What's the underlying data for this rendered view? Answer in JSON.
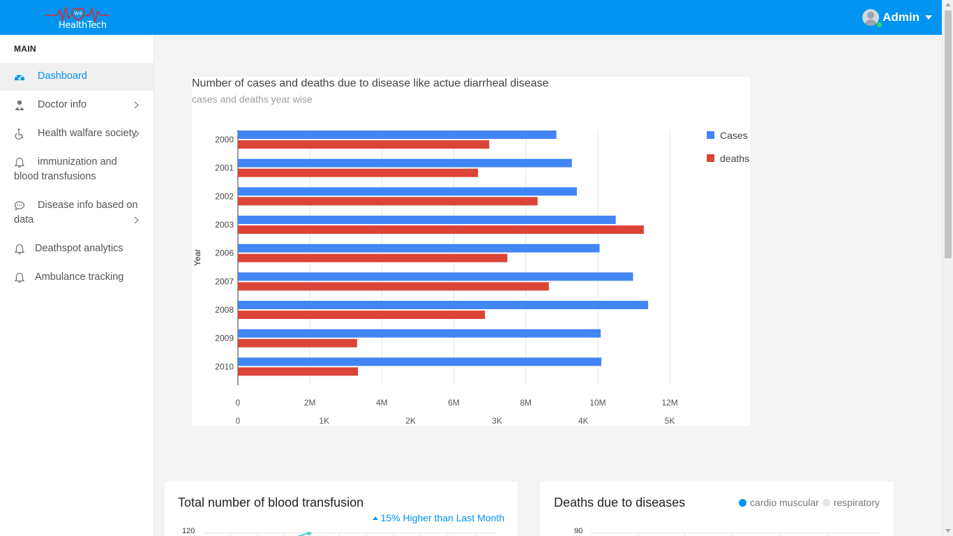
{
  "brand": {
    "logo_text": "HealthTech",
    "logo_mark": "W4"
  },
  "header": {
    "user_name": "Admin"
  },
  "sidebar": {
    "section_label": "MAIN",
    "items": [
      {
        "label": "Dashboard",
        "icon": "dashboard-gauge-icon",
        "active": true
      },
      {
        "label": "Doctor info",
        "icon": "doctor-icon",
        "has_submenu": true
      },
      {
        "label": "Health walfare society",
        "icon": "wheelchair-icon",
        "has_submenu": true
      },
      {
        "label_line1": "immunization and",
        "label_line2": "blood transfusions",
        "icon": "bell-icon"
      },
      {
        "label_line1": "Disease info based on",
        "label_line2": "data",
        "icon": "chat-icon",
        "has_submenu": true
      },
      {
        "label": "Deathspot analytics",
        "icon": "bell-icon"
      },
      {
        "label": "Ambulance tracking",
        "icon": "bell-icon"
      }
    ]
  },
  "main_chart": {
    "title": "Number of cases and deaths due to disease like actue diarrheal disease",
    "subtitle": "cases and deaths year wise"
  },
  "chart_data": {
    "type": "bar",
    "orientation": "horizontal",
    "title": "Number of cases and deaths due to disease like actue diarrheal disease",
    "subtitle": "cases and deaths year wise",
    "ylabel": "Year",
    "categories": [
      "2000",
      "2001",
      "2002",
      "2003",
      "2006",
      "2007",
      "2008",
      "2009",
      "2010"
    ],
    "series": [
      {
        "name": "Cases",
        "color": "#4285f4",
        "axis": "primary",
        "values": [
          8850000,
          9280000,
          9420000,
          10500000,
          10050000,
          10980000,
          11400000,
          10080000,
          10100000
        ]
      },
      {
        "name": "deaths",
        "color": "#db4437",
        "axis": "secondary",
        "values": [
          2910,
          2780,
          3470,
          4700,
          3120,
          3600,
          2860,
          1380,
          1390
        ]
      }
    ],
    "primary_axis": {
      "min": 0,
      "max": 12000000,
      "ticks": [
        "0",
        "2M",
        "4M",
        "6M",
        "8M",
        "10M",
        "12M"
      ]
    },
    "secondary_axis": {
      "min": 0,
      "max": 5000,
      "ticks": [
        "0",
        "1K",
        "2K",
        "3K",
        "4K",
        "5K"
      ]
    },
    "grid": true,
    "legend_position": "right"
  },
  "blood_card": {
    "title": "Total number of blood transfusion",
    "trend_text": "15% Higher than Last Month",
    "first_tick": "120"
  },
  "deaths_card": {
    "title": "Deaths due to diseases",
    "legend": [
      {
        "label": "cardio muscular",
        "color": "#0394f1"
      },
      {
        "label": "respiratory",
        "color": "#e5e5e5"
      }
    ],
    "first_tick": "90"
  }
}
